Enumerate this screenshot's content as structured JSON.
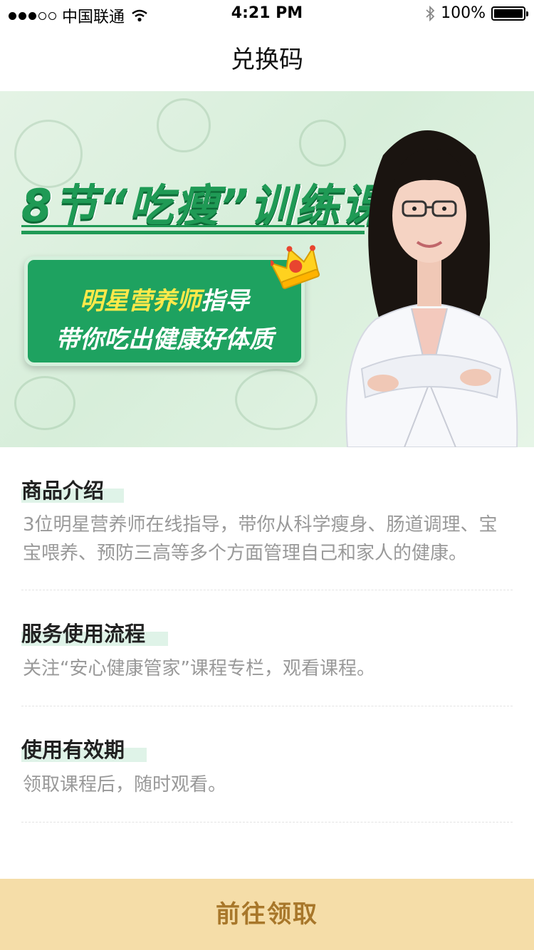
{
  "status_bar": {
    "carrier": "中国联通",
    "time": "4:21 PM",
    "battery": "100%",
    "signal_bars_filled": 3,
    "signal_bars_total": 5
  },
  "nav": {
    "title": "兑换码"
  },
  "banner": {
    "title": "8节“吃瘦”训练课",
    "line1_highlight": "明星营养师",
    "line1_rest": "指导",
    "line2": "带你吃出健康好体质",
    "accent_color": "#1f9a55"
  },
  "sections": [
    {
      "title": "商品介绍",
      "text": "3位明星营养师在线指导，带你从科学瘦身、肠道调理、宝宝喂养、预防三高等多个方面管理自己和家人的健康。"
    },
    {
      "title": "服务使用流程",
      "text": "关注“安心健康管家”课程专栏，观看课程。"
    },
    {
      "title": "使用有效期",
      "text": "领取课程后，随时观看。"
    }
  ],
  "bottom_button": {
    "label": "前往领取",
    "bg_color": "#f5dda8",
    "text_color": "#a8772a"
  }
}
